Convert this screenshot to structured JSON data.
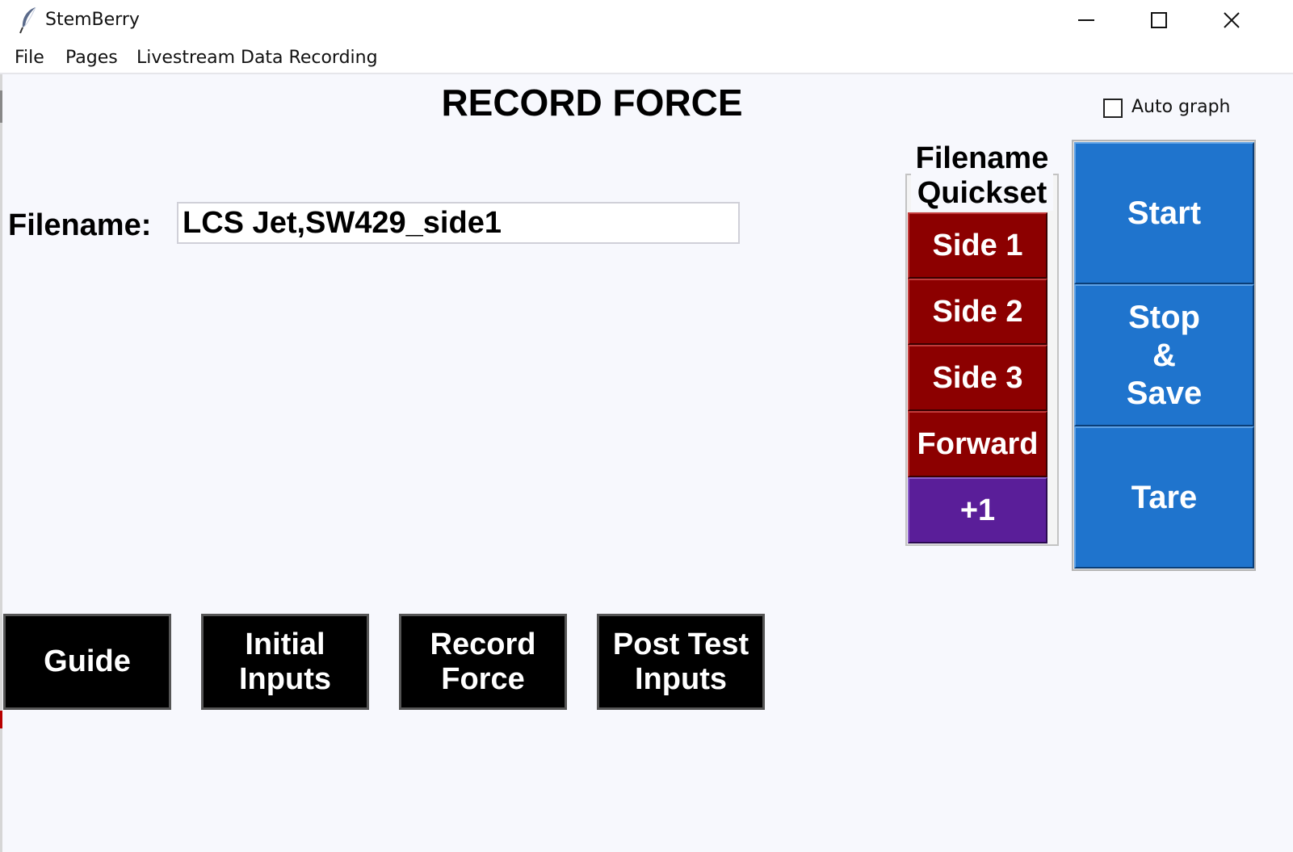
{
  "window": {
    "title": "StemBerry",
    "icon": "feather-icon",
    "controls": [
      "minimize-icon",
      "maximize-icon",
      "close-icon"
    ]
  },
  "menu": [
    "File",
    "Pages",
    "Livestream Data Recording"
  ],
  "page": {
    "title": "RECORD FORCE",
    "auto_graph_label": "Auto graph",
    "auto_graph_checked": false,
    "filename_label": "Filename:",
    "filename_value": "LCS Jet,SW429_side1"
  },
  "quickset": {
    "label_line1": "Filename",
    "label_line2": "Quickset",
    "buttons": [
      "Side 1",
      "Side 2",
      "Side 3",
      "Forward",
      "+1"
    ]
  },
  "controls": {
    "start": "Start",
    "stop_line1": "Stop",
    "stop_line2": "&",
    "stop_line3": "Save",
    "tare": "Tare"
  },
  "nav": [
    {
      "line1": "Guide",
      "line2": ""
    },
    {
      "line1": "Initial",
      "line2": "Inputs"
    },
    {
      "line1": "Record",
      "line2": "Force"
    },
    {
      "line1": "Post Test",
      "line2": "Inputs"
    }
  ],
  "colors": {
    "quickset_red": "#8c0000",
    "quickset_purple": "#5a1e99",
    "control_blue": "#1f74cd",
    "nav_black": "#000000",
    "background": "#f7f8fd"
  }
}
